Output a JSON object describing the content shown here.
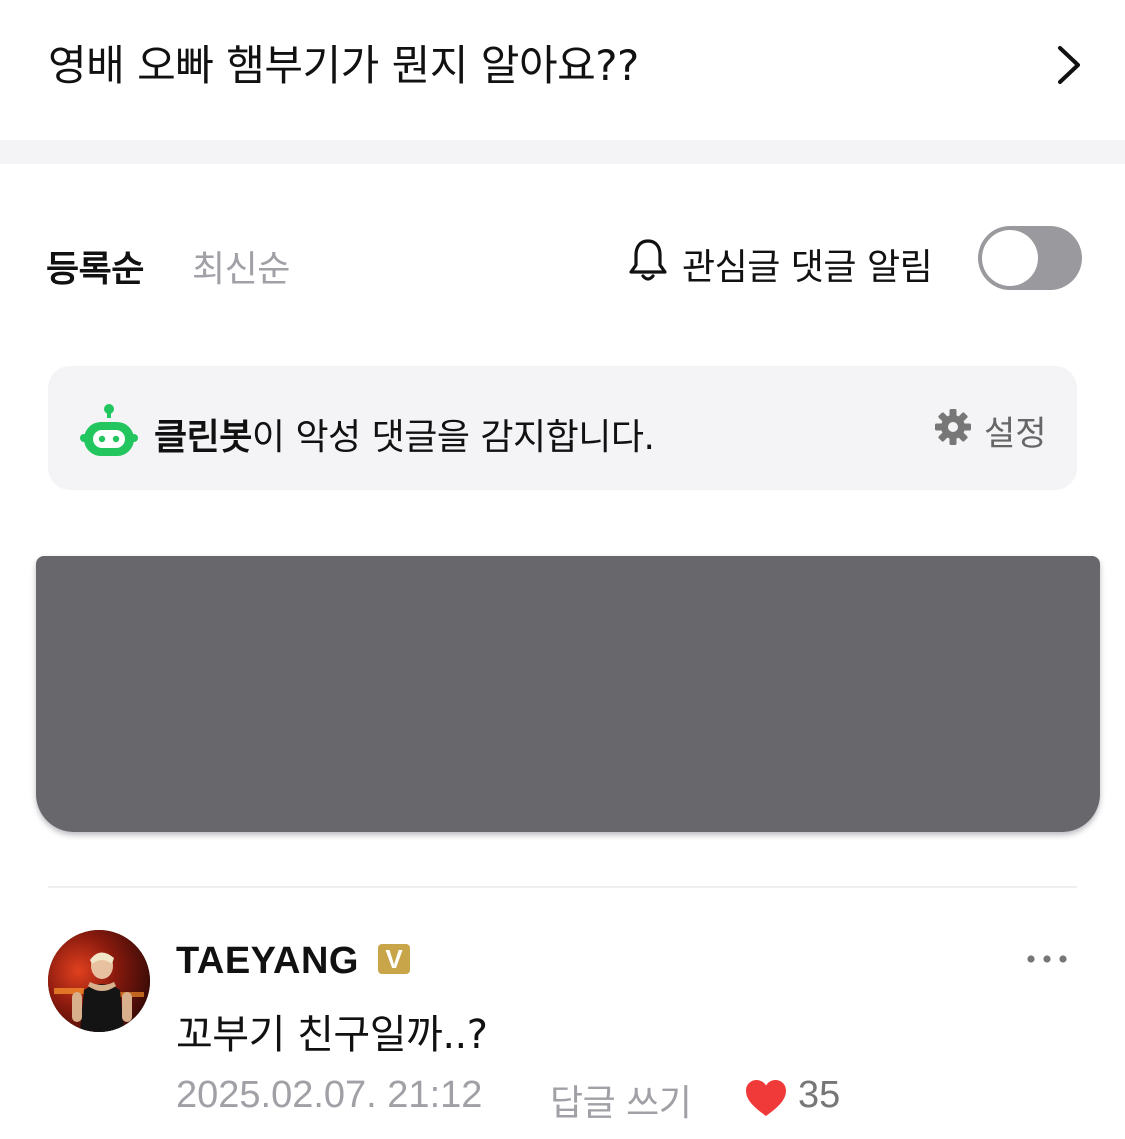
{
  "post": {
    "title": "영배 오빠 햄부기가 뭔지 알아요??"
  },
  "sort": {
    "tabs": [
      {
        "label": "등록순",
        "active": true
      },
      {
        "label": "최신순",
        "active": false
      }
    ]
  },
  "notifications": {
    "label": "관심글 댓글 알림",
    "enabled": false
  },
  "cleanbot": {
    "name": "클린봇",
    "message": "이 악성 댓글을 감지합니다.",
    "settings_label": "설정"
  },
  "comment": {
    "author": "TAEYANG",
    "badge": "V",
    "body": "꼬부기 친구일까..?",
    "date": "2025.02.07. 21:12",
    "reply_label": "답글 쓰기",
    "likes": "35"
  },
  "colors": {
    "accent_green": "#22c55e",
    "heart_red": "#f03a3a",
    "verified_gold": "#c9a54a",
    "redaction_gray": "#68686c"
  }
}
